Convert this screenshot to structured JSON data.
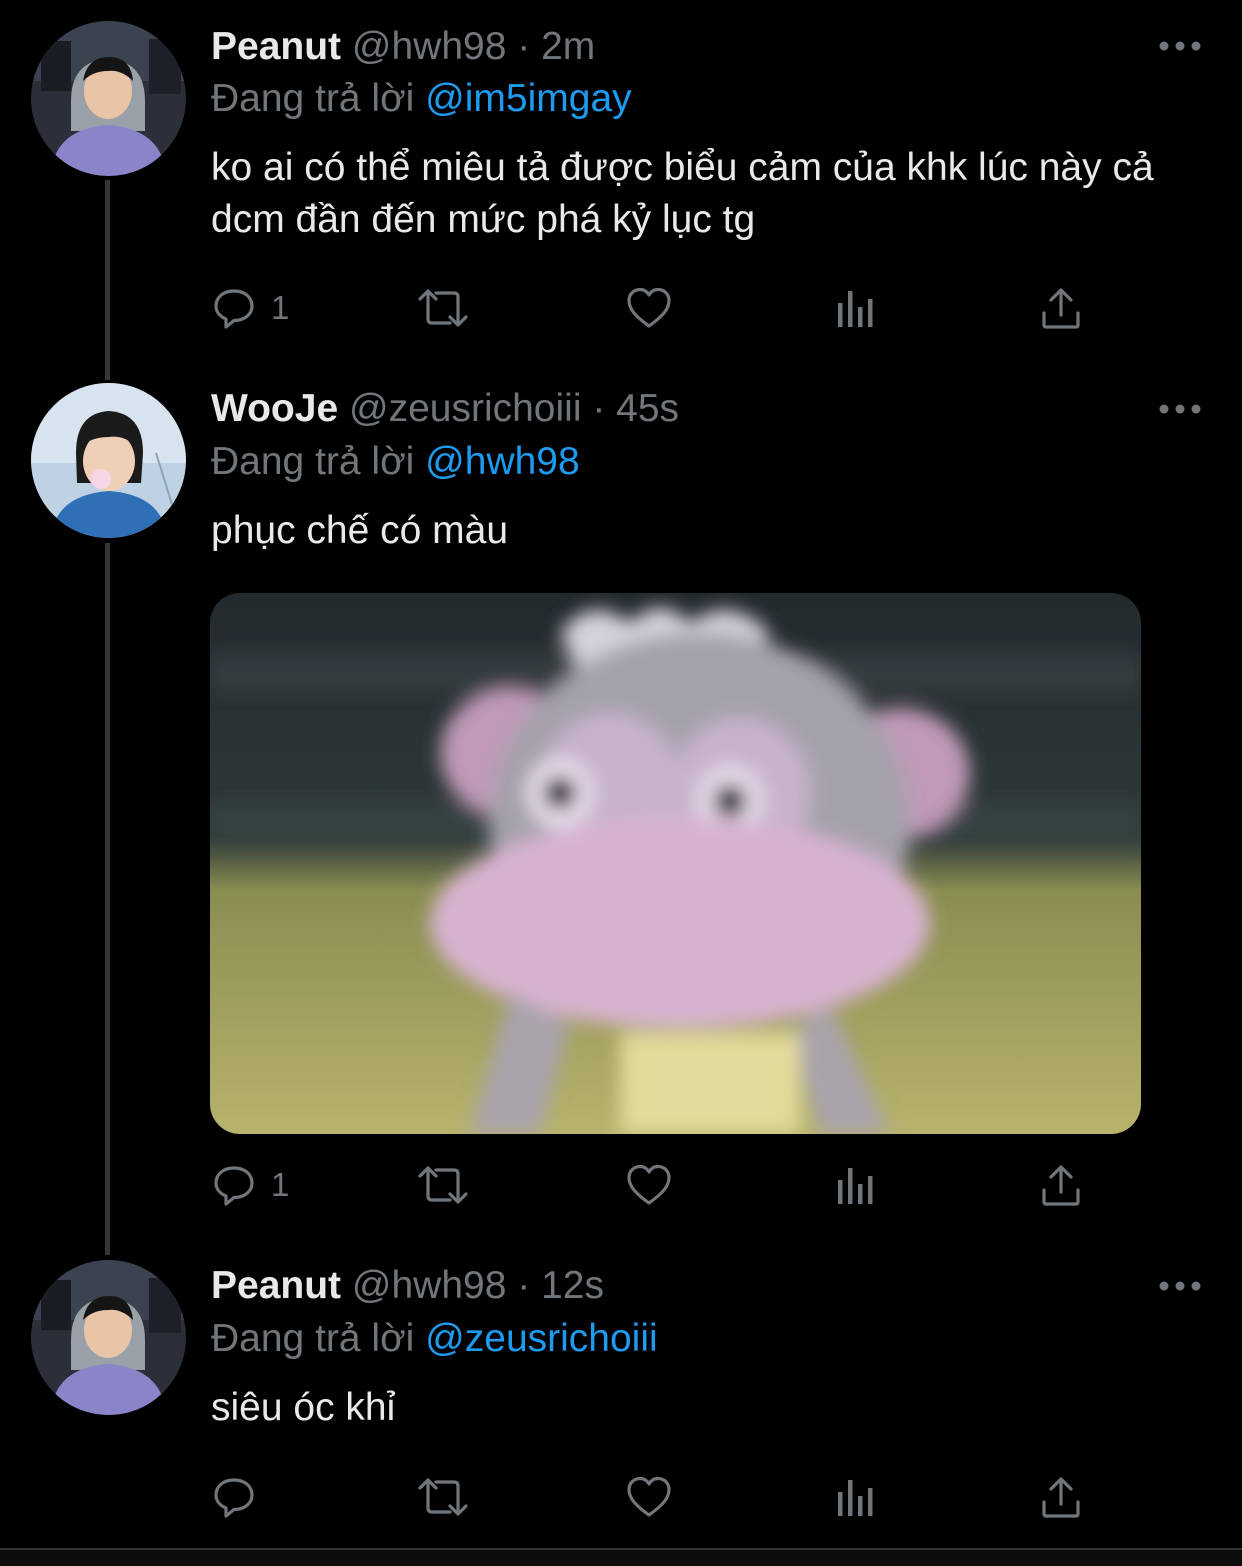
{
  "tweets": [
    {
      "name": "Peanut",
      "handle": "@hwh98",
      "dot": "·",
      "time": "2m",
      "reply_prefix": "Đang trả lời",
      "reply_to": "@im5imgay",
      "text": "ko ai có thể miêu tả được biểu cảm của khk lúc này cả dcm đần đến mức phá kỷ lục tg",
      "reply_count": "1",
      "avatar": "avatar-peanut"
    },
    {
      "name": "WooJe",
      "handle": "@zeusrichoiii",
      "dot": "·",
      "time": "45s",
      "reply_prefix": "Đang trả lời",
      "reply_to": "@hwh98",
      "text": "phục chế có màu",
      "reply_count": "1",
      "avatar": "avatar-wooje"
    },
    {
      "name": "Peanut",
      "handle": "@hwh98",
      "dot": "·",
      "time": "12s",
      "reply_prefix": "Đang trả lời",
      "reply_to": "@zeusrichoiii",
      "text": "siêu óc khỉ",
      "reply_count": "",
      "avatar": "avatar-peanut"
    }
  ],
  "icons": {
    "reply": "reply-icon",
    "retweet": "retweet-icon",
    "like": "heart-icon",
    "views": "views-icon",
    "share": "share-icon",
    "more": "more-icon"
  },
  "colors": {
    "background": "#000000",
    "text": "#e7e9ea",
    "secondary": "#71767b",
    "accent": "#1d9bf0"
  }
}
